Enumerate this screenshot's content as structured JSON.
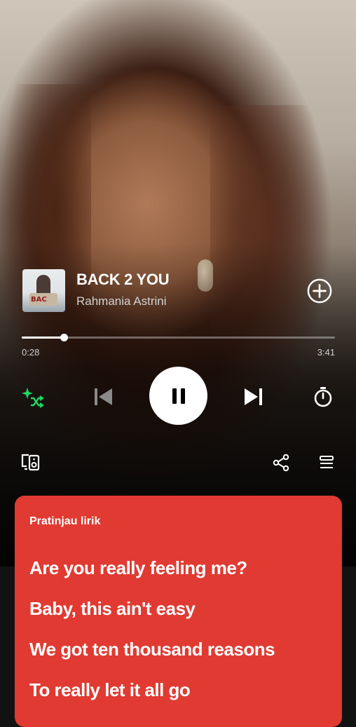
{
  "now_playing": {
    "title": "BACK 2 YOU",
    "artist": "Rahmania Astrini",
    "album_art_text": "BAC",
    "progress_fraction": 0.135
  },
  "progress": {
    "current_time": "0:28",
    "total_time": "3:41"
  },
  "icons": {
    "add": "plus-circle-icon",
    "smart_shuffle": "smart-shuffle-icon",
    "previous": "skip-previous-icon",
    "play_pause": "pause-icon",
    "next": "skip-next-icon",
    "sleep_timer": "timer-icon",
    "devices": "connect-device-icon",
    "share": "share-icon",
    "queue": "queue-icon"
  },
  "colors": {
    "accent": "#1ed760",
    "lyrics_card": "#e03a32",
    "background": "#121212"
  },
  "lyrics": {
    "header": "Pratinjau lirik",
    "lines": [
      "Are you really feeling me?",
      "Baby, this ain't easy",
      "We got ten thousand reasons",
      "To really let it all go"
    ]
  }
}
